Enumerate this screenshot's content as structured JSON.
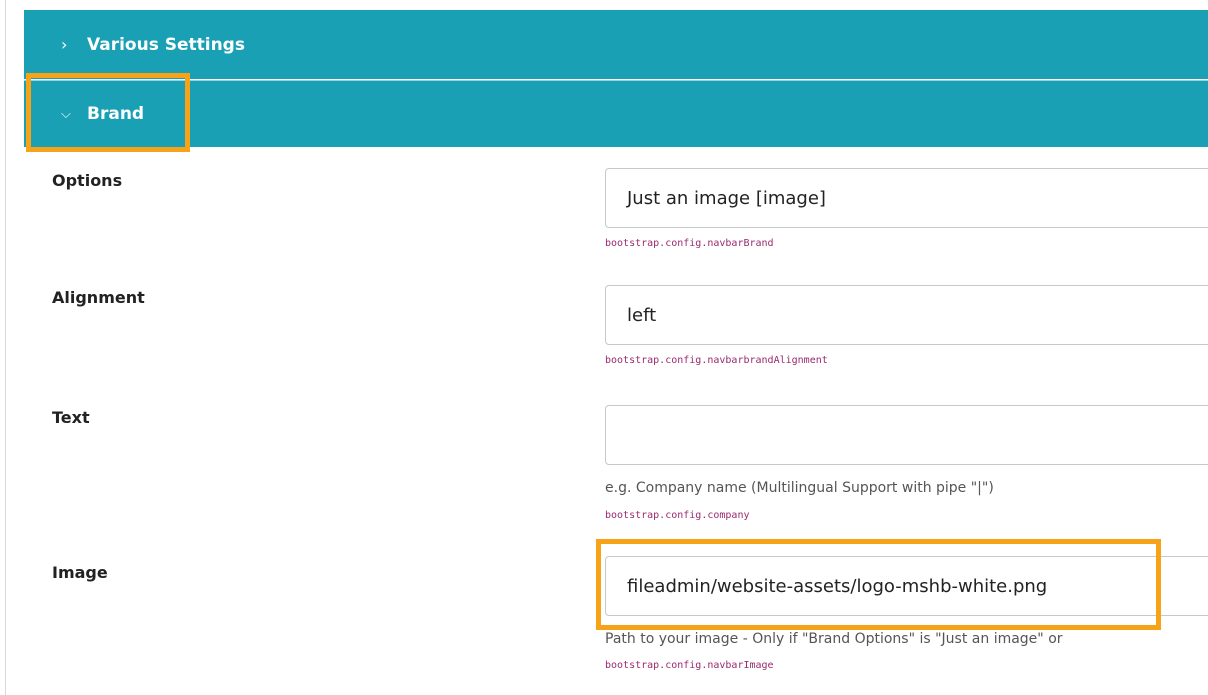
{
  "sections": {
    "various_settings": {
      "label": "Various Settings",
      "state": "collapsed",
      "icon": "chevron-right-icon"
    },
    "brand": {
      "label": "Brand",
      "state": "expanded",
      "icon": "chevron-down-icon"
    }
  },
  "fields": {
    "options": {
      "label": "Options",
      "value": "Just an image [image]",
      "code": "bootstrap.config.navbarBrand"
    },
    "alignment": {
      "label": "Alignment",
      "value": "left",
      "code": "bootstrap.config.navbarbrandAlignment"
    },
    "text": {
      "label": "Text",
      "value": "",
      "help": "e.g. Company name (Multilingual Support with pipe \"|\")",
      "code": "bootstrap.config.company"
    },
    "image": {
      "label": "Image",
      "value": "fileadmin/website-assets/logo-mshb-white.png",
      "help": "Path to your image - Only if \"Brand Options\" is \"Just an image\" or",
      "code": "bootstrap.config.navbarImage"
    }
  },
  "colors": {
    "header_bg": "#1aa0b4",
    "highlight": "#f6a31a",
    "code_text": "#9b2a6e"
  }
}
